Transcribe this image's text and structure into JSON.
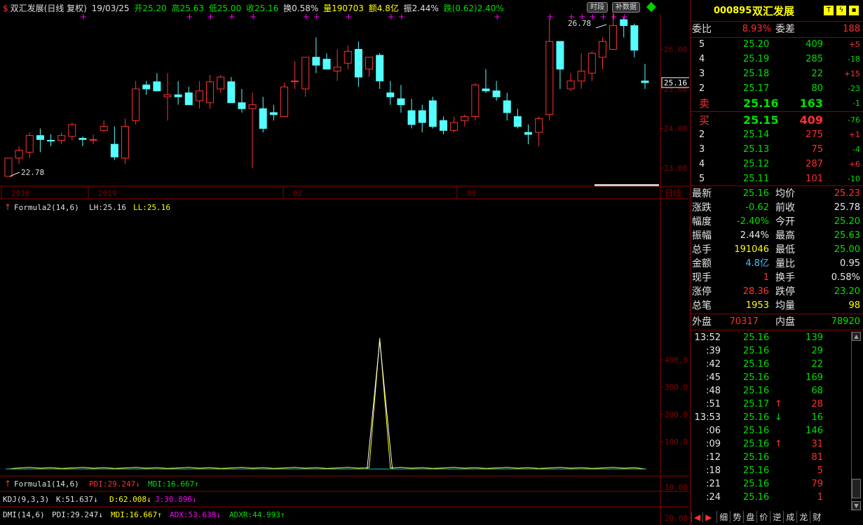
{
  "header": {
    "title": "双汇发展(日线 复权)",
    "date": "19/03/25",
    "open": "开25.20",
    "high": "高25.63",
    "low": "低25.00",
    "close": "收25.16",
    "turnover": "换0.58%",
    "volume": "量190703",
    "amount": "额4.8亿",
    "amplitude": "振2.44%",
    "change": "跌(0.62)2.40%",
    "btn_timeshare": "时段",
    "btn_supplement": "补数据"
  },
  "colors": {
    "up": "#ff3232",
    "down": "#54ffff",
    "bg": "#000000",
    "grid": "#8b0000",
    "accent": "#ffff00"
  },
  "candle_chart": {
    "y_axis": [
      "26.00",
      "25.00",
      "24.00",
      "23.00"
    ],
    "current_price": "25.16",
    "high_label": "26.78",
    "low_label": "22.78",
    "x_labels": [
      "2018",
      "2019",
      "02",
      "03"
    ],
    "period_label": "日线",
    "candles": [
      [
        22.79,
        23.25,
        22.78,
        23.25
      ],
      [
        23.25,
        23.55,
        23.1,
        23.45
      ],
      [
        23.4,
        23.9,
        23.25,
        23.82
      ],
      [
        23.82,
        24.0,
        23.4,
        23.72
      ],
      [
        23.7,
        23.85,
        23.55,
        23.68
      ],
      [
        23.7,
        23.9,
        23.6,
        23.82
      ],
      [
        23.8,
        24.15,
        23.7,
        24.1
      ],
      [
        23.75,
        23.8,
        23.55,
        23.72
      ],
      [
        23.72,
        23.85,
        23.6,
        23.72
      ],
      [
        23.95,
        24.2,
        23.9,
        24.05
      ],
      [
        23.6,
        24.05,
        23.2,
        23.28
      ],
      [
        23.25,
        24.25,
        23.1,
        24.05
      ],
      [
        24.2,
        25.2,
        24.1,
        25.0
      ],
      [
        25.1,
        25.2,
        24.85,
        25.0
      ],
      [
        25.18,
        25.4,
        24.95,
        24.95
      ],
      [
        24.8,
        25.4,
        24.2,
        24.85
      ],
      [
        24.85,
        25.2,
        24.6,
        24.8
      ],
      [
        24.9,
        25.05,
        24.7,
        24.6
      ],
      [
        24.7,
        25.2,
        24.5,
        24.95
      ],
      [
        24.65,
        25.35,
        24.5,
        25.18
      ],
      [
        25.0,
        25.35,
        24.9,
        25.3
      ],
      [
        25.18,
        25.3,
        24.9,
        24.65
      ],
      [
        24.65,
        25.0,
        24.4,
        24.5
      ],
      [
        24.5,
        24.9,
        23.0,
        24.6
      ],
      [
        24.5,
        24.8,
        23.9,
        24.0
      ],
      [
        24.4,
        24.6,
        24.2,
        24.35
      ],
      [
        24.3,
        25.15,
        24.3,
        25.05
      ],
      [
        25.2,
        25.7,
        25.0,
        25.2
      ],
      [
        25.0,
        25.7,
        24.8,
        25.8
      ],
      [
        25.8,
        26.3,
        25.4,
        25.6
      ],
      [
        25.75,
        25.9,
        25.5,
        25.5
      ],
      [
        25.45,
        26.0,
        25.2,
        25.55
      ],
      [
        25.65,
        26.1,
        25.5,
        25.95
      ],
      [
        26.0,
        26.2,
        25.05,
        25.3
      ],
      [
        25.5,
        25.8,
        25.3,
        25.8
      ],
      [
        25.85,
        25.9,
        25.0,
        25.2
      ],
      [
        24.9,
        25.2,
        24.6,
        24.8
      ],
      [
        24.75,
        25.1,
        24.4,
        24.6
      ],
      [
        24.45,
        24.75,
        24.0,
        24.1
      ],
      [
        24.45,
        24.6,
        23.9,
        24.15
      ],
      [
        24.7,
        24.8,
        24.0,
        24.05
      ],
      [
        24.2,
        24.3,
        23.85,
        23.95
      ],
      [
        23.95,
        24.3,
        23.9,
        24.15
      ],
      [
        24.2,
        24.35,
        24.05,
        24.3
      ],
      [
        24.3,
        25.15,
        24.2,
        25.1
      ],
      [
        25.0,
        25.5,
        24.9,
        24.95
      ],
      [
        24.95,
        25.2,
        24.7,
        24.8
      ],
      [
        24.7,
        24.9,
        24.2,
        24.4
      ],
      [
        24.3,
        24.5,
        24.0,
        24.05
      ],
      [
        23.9,
        24.1,
        23.6,
        23.85
      ],
      [
        23.9,
        24.3,
        23.55,
        24.25
      ],
      [
        24.35,
        26.78,
        24.2,
        26.2
      ],
      [
        26.2,
        26.2,
        25.0,
        25.5
      ],
      [
        25.0,
        25.4,
        24.95,
        25.2
      ],
      [
        25.2,
        25.9,
        25.0,
        25.45
      ],
      [
        25.4,
        25.95,
        25.2,
        25.9
      ],
      [
        25.8,
        26.3,
        25.5,
        26.2
      ],
      [
        26.0,
        26.95,
        26.0,
        26.6
      ],
      [
        26.75,
        26.8,
        26.3,
        26.6
      ],
      [
        26.6,
        26.65,
        25.8,
        25.98
      ],
      [
        25.2,
        25.63,
        25.0,
        25.16
      ]
    ]
  },
  "formula2": {
    "label": "Formula2(14,6)",
    "lh": "LH:25.16",
    "ll": "LL:25.16",
    "y_axis": [
      "400.0",
      "300.0",
      "200.0",
      "100.0"
    ],
    "spike_index": 35,
    "spike_value": 480
  },
  "formula1": {
    "label": "Formula1(14,6)",
    "pdi": "PDI:29.247",
    "mdi": "MDI:16.667",
    "y_axis": "10.00"
  },
  "kdj": {
    "label": "KDJ(9,3,3)",
    "k": "K:51.637",
    "d": "D:62.008",
    "j": "J:30.896"
  },
  "dmi": {
    "label": "DMI(14,6)",
    "pdi": "PDI:29.247",
    "mdi": "MDI:16.667",
    "adx": "ADX:53.638",
    "adxr": "ADXR:44.993",
    "y_axis": "20.00"
  },
  "quote": {
    "code": "000895",
    "name": "双汇发展",
    "weibi_label": "委比",
    "weibi": "8.93%",
    "weicha_label": "委差",
    "weicha": "188",
    "sell": [
      {
        "lvl": "5",
        "price": "25.20",
        "vol": "409",
        "chg": "+5"
      },
      {
        "lvl": "4",
        "price": "25.19",
        "vol": "285",
        "chg": "-18"
      },
      {
        "lvl": "3",
        "price": "25.18",
        "vol": "22",
        "chg": "+15"
      },
      {
        "lvl": "2",
        "price": "25.17",
        "vol": "80",
        "chg": "-23"
      },
      {
        "lvl": "卖",
        "price": "25.16",
        "vol": "163",
        "chg": "-1"
      }
    ],
    "buy": [
      {
        "lvl": "买",
        "price": "25.15",
        "vol": "409",
        "chg": "-76"
      },
      {
        "lvl": "2",
        "price": "25.14",
        "vol": "275",
        "chg": "+1"
      },
      {
        "lvl": "3",
        "price": "25.13",
        "vol": "75",
        "chg": "-4"
      },
      {
        "lvl": "4",
        "price": "25.12",
        "vol": "287",
        "chg": "+6"
      },
      {
        "lvl": "5",
        "price": "25.11",
        "vol": "101",
        "chg": "-10"
      }
    ],
    "stats": [
      {
        "l1": "最新",
        "v1": "25.16",
        "c1": "grn",
        "l2": "均价",
        "v2": "25.23",
        "c2": "red"
      },
      {
        "l1": "涨跌",
        "v1": "-0.62",
        "c1": "grn",
        "l2": "前收",
        "v2": "25.78",
        "c2": "wht"
      },
      {
        "l1": "幅度",
        "v1": "-2.40%",
        "c1": "grn",
        "l2": "今开",
        "v2": "25.20",
        "c2": "grn"
      },
      {
        "l1": "振幅",
        "v1": "2.44%",
        "c1": "wht",
        "l2": "最高",
        "v2": "25.63",
        "c2": "grn"
      },
      {
        "l1": "总手",
        "v1": "191046",
        "c1": "yel",
        "l2": "最低",
        "v2": "25.00",
        "c2": "grn"
      },
      {
        "l1": "金额",
        "v1": "4.8亿",
        "c1": "cyn",
        "l2": "量比",
        "v2": "0.95",
        "c2": "wht"
      },
      {
        "l1": "现手",
        "v1": "1",
        "c1": "red",
        "l2": "换手",
        "v2": "0.58%",
        "c2": "wht"
      },
      {
        "l1": "涨停",
        "v1": "28.36",
        "c1": "red",
        "l2": "跌停",
        "v2": "23.20",
        "c2": "grn"
      },
      {
        "l1": "总笔",
        "v1": "1953",
        "c1": "yel",
        "l2": "均量",
        "v2": "98",
        "c2": "yel"
      }
    ],
    "outer_label": "外盘",
    "outer": "70317",
    "inner_label": "内盘",
    "inner": "78920",
    "ticks": [
      {
        "t": "13:52",
        "p": "25.16",
        "a": "",
        "v": "139",
        "vc": "grn"
      },
      {
        "t": ":39",
        "p": "25.16",
        "a": "",
        "v": "29",
        "vc": "grn"
      },
      {
        "t": ":42",
        "p": "25.16",
        "a": "",
        "v": "22",
        "vc": "grn"
      },
      {
        "t": ":45",
        "p": "25.16",
        "a": "",
        "v": "169",
        "vc": "grn"
      },
      {
        "t": ":48",
        "p": "25.16",
        "a": "",
        "v": "68",
        "vc": "grn"
      },
      {
        "t": ":51",
        "p": "25.17",
        "a": "↑",
        "v": "28",
        "vc": "red"
      },
      {
        "t": "13:53",
        "p": "25.16",
        "a": "↓",
        "v": "16",
        "vc": "grn"
      },
      {
        "t": ":06",
        "p": "25.16",
        "a": "",
        "v": "146",
        "vc": "grn"
      },
      {
        "t": ":09",
        "p": "25.16",
        "a": "↑",
        "v": "31",
        "vc": "red"
      },
      {
        "t": ":12",
        "p": "25.16",
        "a": "",
        "v": "81",
        "vc": "red"
      },
      {
        "t": ":18",
        "p": "25.16",
        "a": "",
        "v": "5",
        "vc": "red"
      },
      {
        "t": ":21",
        "p": "25.16",
        "a": "",
        "v": "79",
        "vc": "red"
      },
      {
        "t": ":24",
        "p": "25.16",
        "a": "",
        "v": "1",
        "vc": "red"
      }
    ],
    "tabs": [
      "细",
      "势",
      "盘",
      "价",
      "逆",
      "成",
      "龙",
      "财"
    ]
  }
}
